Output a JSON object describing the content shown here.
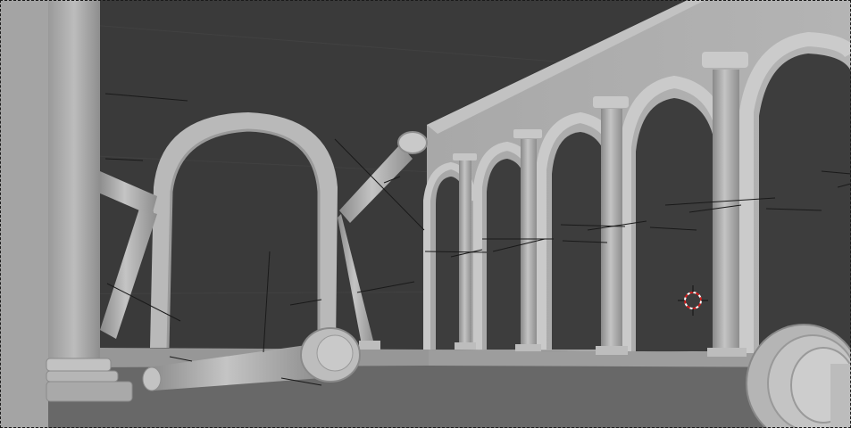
{
  "viewport": {
    "mode": "solid-shading",
    "colors": {
      "background": "#3a3a3a",
      "floor": "#6b6b6b",
      "geometry_light": "#bdbdbd",
      "geometry_mid": "#a9a9a9",
      "geometry_dark": "#8c8c8c",
      "edge_lines": "#1a1a1a",
      "cursor_red": "#d21f1f",
      "cursor_white": "#ffffff"
    },
    "icons": [
      "3d-cursor-icon"
    ]
  }
}
